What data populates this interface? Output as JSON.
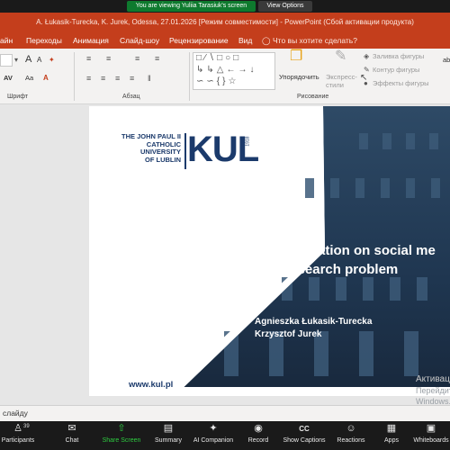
{
  "zoom": {
    "banner_text": "You are viewing Yuliia Tarasiuk's screen",
    "view_options": "View Options",
    "participants_count": "39",
    "toolbar": [
      {
        "label": "Participants",
        "icon": "people-icon"
      },
      {
        "label": "Chat",
        "icon": "chat-icon"
      },
      {
        "label": "Share Screen",
        "icon": "share-screen-icon"
      },
      {
        "label": "Summary",
        "icon": "summary-icon"
      },
      {
        "label": "AI Companion",
        "icon": "ai-companion-icon"
      },
      {
        "label": "Record",
        "icon": "record-icon"
      },
      {
        "label": "Show Captions",
        "icon": "captions-icon"
      },
      {
        "label": "Reactions",
        "icon": "reactions-icon"
      },
      {
        "label": "Apps",
        "icon": "apps-icon"
      },
      {
        "label": "Whiteboards",
        "icon": "whiteboard-icon"
      }
    ],
    "cc_badge": "CC"
  },
  "powerpoint": {
    "title": "A. Łukasik-Turecka, K. Jurek, Odessa, 27.01.2026 [Режим совместимости] - PowerPoint (Сбой активации продукта)",
    "tabs": [
      "айн",
      "Переходы",
      "Анимация",
      "Слайд-шоу",
      "Рецензирование",
      "Вид"
    ],
    "tell_me": "Что вы хотите сделать?",
    "ribbon": {
      "font_group": "Шрифт",
      "paragraph_group": "Абзац",
      "drawing_group": "Рисование",
      "arrange": "Упорядочить",
      "quick_styles": "Экспресс-стили",
      "fill": "Заливка фигуры",
      "outline": "Контур фигуры",
      "effects": "Эффекты фигуры",
      "font_a_large": "A",
      "font_a_small": "A",
      "av": "AV",
      "aa": "Aa",
      "ab": "ab"
    },
    "notes_label": "слайду",
    "activation_watermark": [
      "Активац",
      "Перейдит",
      "Windows."
    ]
  },
  "slide": {
    "university_lines": [
      "THE JOHN PAUL II",
      "CATHOLIC",
      "UNIVERSITY",
      "OF LUBLIN"
    ],
    "logo": "KUL",
    "logo_year": "1918",
    "title_line1": "Disinformation on social me",
    "title_line2": "as a research problem",
    "author1": "Agnieszka Łukasik-Turecka",
    "author2": "Krzysztof Jurek",
    "url": "www.kul.pl"
  },
  "colors": {
    "ppt_red": "#c43e1c",
    "kul_navy": "#1b3a6b",
    "zoom_green": "#0e7a2e"
  }
}
